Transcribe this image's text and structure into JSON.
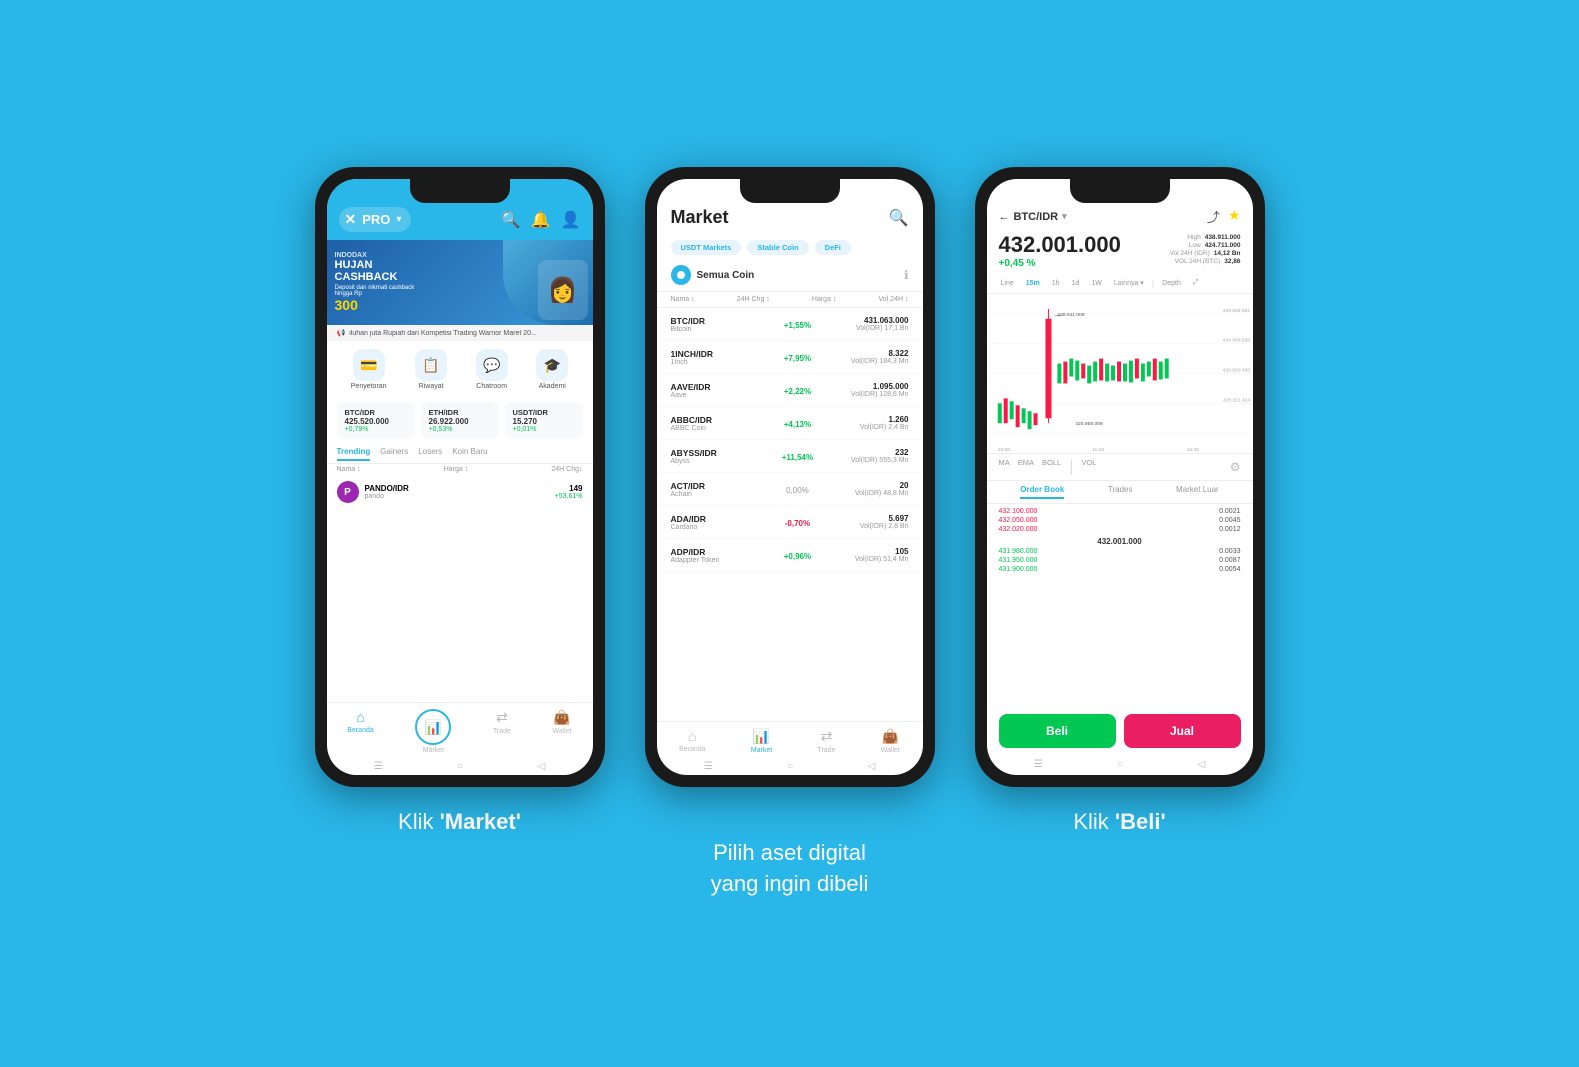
{
  "background": "#29b6e8",
  "phones": [
    {
      "id": "phone1",
      "caption": "Klik 'Market'",
      "caption_plain": "Klik ",
      "caption_bold": "Market",
      "header": {
        "logo": "PRO",
        "icons": [
          "🔍",
          "🔔",
          "👤"
        ]
      },
      "banner": {
        "title": "HUJAN\nCASHBACK",
        "subtitle": "Deposit dan nikmati cashback\nhingga Rp",
        "amount": "300",
        "brand": "INDODAX"
      },
      "ticker": "iluhan juta Rupiah dari Kompetisi Trading Warrior Maret 20...",
      "menu": [
        {
          "icon": "💳",
          "label": "Penyetoran"
        },
        {
          "icon": "📋",
          "label": "Riwayat"
        },
        {
          "icon": "💬",
          "label": "Chatroom"
        },
        {
          "icon": "🎓",
          "label": "Akademi"
        }
      ],
      "prices": [
        {
          "pair": "BTC/IDR",
          "value": "425.520.000",
          "change": "+0,79%"
        },
        {
          "pair": "ETH/IDR",
          "value": "26.922.000",
          "change": "+0,53%"
        },
        {
          "pair": "USDT/IDR",
          "value": "15.270",
          "change": "+0,01%"
        }
      ],
      "tabs": [
        "Trending",
        "Gainers",
        "Losers",
        "Koin Baru"
      ],
      "active_tab": "Trending",
      "col_headers": [
        "Nama ↕",
        "Harga ↕",
        "24H Chg↕"
      ],
      "rows": [
        {
          "icon": "P",
          "pair": "PANDO/IDR",
          "name": "pando",
          "price": "149",
          "change": "+53,61%"
        }
      ],
      "nav": [
        {
          "icon": "🏠",
          "label": "Beranda",
          "active": true
        },
        {
          "icon": "📊",
          "label": "Market",
          "active": false,
          "circle": true
        },
        {
          "icon": "↔",
          "label": "Trade",
          "active": false
        },
        {
          "icon": "👜",
          "label": "Wallet",
          "active": false
        }
      ]
    },
    {
      "id": "phone2",
      "caption": "Pilih aset digital\nyang ingin dibeli",
      "header": {
        "title": "Market",
        "search_icon": "🔍"
      },
      "filter_tabs": [
        "USDT Markets",
        "Stable Coin",
        "DeFi"
      ],
      "coin_selector": "Semua Coin",
      "col_headers": [
        "Nama ↕",
        "24H Chg ↕",
        "Harga ↕",
        "Vol 24H ↕"
      ],
      "rows": [
        {
          "pair": "BTC/IDR",
          "name": "Bitcoin",
          "change": "+1,55%",
          "change_type": "pos",
          "price": "431.063.000",
          "vol": "Vol(IDR) 17,1 Bn"
        },
        {
          "pair": "1INCH/IDR",
          "name": "1Inch",
          "change": "+7,95%",
          "change_type": "pos",
          "price": "8.322",
          "vol": "Vol(IDR) 184,3 Mn"
        },
        {
          "pair": "AAVE/IDR",
          "name": "Aave",
          "change": "+2,22%",
          "change_type": "pos",
          "price": "1.095.000",
          "vol": "Vol(IDR) 128,6 Mn"
        },
        {
          "pair": "ABBC/IDR",
          "name": "ABBC Coin",
          "change": "+4,13%",
          "change_type": "pos",
          "price": "1.260",
          "vol": "Vol(IDR) 2,4 Bn"
        },
        {
          "pair": "ABYSS/IDR",
          "name": "Abyss",
          "change": "+11,54%",
          "change_type": "pos",
          "price": "232",
          "vol": "Vol(IDR) 555,3 Mn"
        },
        {
          "pair": "ACT/IDR",
          "name": "Achain",
          "change": "0,00%",
          "change_type": "zero",
          "price": "20",
          "vol": "Vol(IDR) 48,8 Mn"
        },
        {
          "pair": "ADA/IDR",
          "name": "Cardano",
          "change": "-0,70%",
          "change_type": "neg",
          "price": "5.697",
          "vol": "Vol(IDR) 2,8 Bn"
        },
        {
          "pair": "ADP/IDR",
          "name": "Adappter Token",
          "change": "+0,96%",
          "change_type": "pos",
          "price": "105",
          "vol": "Vol(IDR) 51,4 Mn"
        }
      ],
      "nav": [
        {
          "icon": "🏠",
          "label": "Beranda",
          "active": false
        },
        {
          "icon": "📊",
          "label": "Market",
          "active": true
        },
        {
          "icon": "↔",
          "label": "Trade",
          "active": false
        },
        {
          "icon": "👜",
          "label": "Wallet",
          "active": false
        }
      ]
    },
    {
      "id": "phone3",
      "caption": "Klik 'Beli'",
      "caption_plain": "Klik ",
      "caption_bold": "Beli",
      "header": {
        "pair": "BTC/IDR",
        "back": "←",
        "share": "share",
        "star": "⭐"
      },
      "price": {
        "main": "432.001.000",
        "change": "+0,45 %",
        "high": "438.911.000",
        "low": "424.711.000",
        "vol_idr": "14,12 Bn",
        "vol_btc": "32,86"
      },
      "chart_tabs": [
        "Line",
        "15m",
        "1h",
        "1d",
        "1W",
        "Lainnya ▾",
        "Depth",
        "⤢"
      ],
      "active_chart_tab": "15m",
      "chart_labels": {
        "left_time": "15:00",
        "mid_time": "11:02",
        "right_time": "16:45",
        "prices": [
          "439.558.592",
          "438.911.008",
          "434.809.536",
          "430.060.480",
          "425.311.424",
          "425.959.008"
        ]
      },
      "indicators": [
        "MA",
        "EMA",
        "BOLL",
        "VOL"
      ],
      "order_tabs": [
        "Order Book",
        "Trades",
        "Market Luar"
      ],
      "active_order_tab": "Order Book",
      "buy_label": "Beli",
      "sell_label": "Jual"
    }
  ]
}
